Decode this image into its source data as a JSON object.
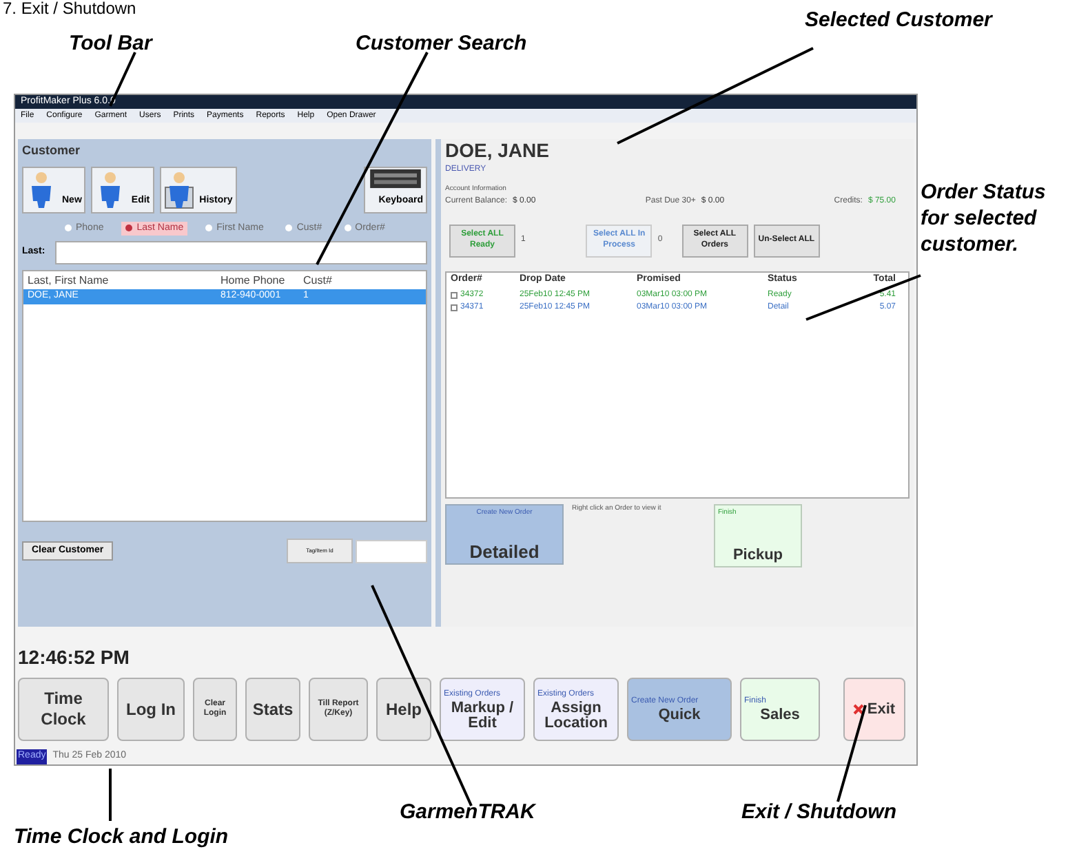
{
  "caption": "7. Exit / Shutdown",
  "callouts": [
    {
      "text": "Tool Bar"
    },
    {
      "text": "Customer Search"
    },
    {
      "text": "Selected Customer"
    },
    {
      "text": "Order Status for selected customer."
    },
    {
      "text": "GarmenTRAK"
    },
    {
      "text": "Time Clock and Login"
    },
    {
      "text": "Exit / Shutdown"
    }
  ],
  "window": {
    "title": "ProfitMaker Plus 6.0.0"
  },
  "menu": [
    "File",
    "Configure",
    "Garment",
    "Users",
    "Prints",
    "Payments",
    "Reports",
    "Help",
    "Open Drawer"
  ],
  "customer_panel": {
    "title": "Customer",
    "buttons": [
      {
        "label": "New",
        "kind": "person"
      },
      {
        "label": "Edit",
        "kind": "person"
      },
      {
        "label": "History",
        "kind": "history"
      },
      {
        "label": "Keyboard",
        "kind": "keyboard"
      }
    ],
    "search_by": [
      {
        "label": "Phone",
        "selected": false
      },
      {
        "label": "Last Name",
        "selected": true
      },
      {
        "label": "First Name",
        "selected": false
      },
      {
        "label": "Cust#",
        "selected": false
      },
      {
        "label": "Order#",
        "selected": false
      }
    ],
    "search_field": {
      "label": "Last:"
    },
    "list": {
      "columns": [
        "Last, First Name",
        "Home Phone",
        "Cust#"
      ],
      "rows": [
        {
          "cells": [
            "DOE, JANE",
            "812-940-0001",
            "1"
          ],
          "selected": true
        }
      ]
    },
    "clear_button": "Clear Customer",
    "tag_button": "Tag/Item Id"
  },
  "clock": "12:46:52 PM",
  "toolbar": [
    {
      "kind": "plain",
      "label": "Time Clock"
    },
    {
      "kind": "plain",
      "label": "Log In"
    },
    {
      "kind": "small",
      "label": "Clear Login"
    },
    {
      "kind": "plain",
      "label": "Stats"
    },
    {
      "kind": "small",
      "label": "Till Report (Z/Key)"
    },
    {
      "kind": "plain",
      "label": "Help"
    },
    {
      "kind": "tile",
      "caption": "Existing Orders",
      "label": "Markup / Edit",
      "color": "#eeeefb"
    },
    {
      "kind": "tile",
      "caption": "Existing Orders",
      "label": "Assign Location",
      "color": "#eeeefb"
    },
    {
      "kind": "tile",
      "caption": "Create New Order",
      "label": "Quick",
      "color": "#a9c1e1"
    },
    {
      "kind": "tile",
      "caption": "Finish",
      "label": "Sales",
      "color": "#e9fbe9"
    },
    {
      "kind": "exit",
      "label": "Exit",
      "color": "#fde5e5"
    }
  ],
  "status_bar": {
    "state": "Ready",
    "date": "Thu 25 Feb 2010"
  },
  "selected_customer": {
    "name": "DOE, JANE",
    "route": "DELIVERY",
    "account_heading": "Account Information",
    "balances": [
      {
        "label": "Current Balance:",
        "value": "$  0.00",
        "color": "#333333"
      },
      {
        "label": "Past Due 30+",
        "value": "$  0.00",
        "color": "#333333"
      },
      {
        "label": "Credits:",
        "value": "$  75.00",
        "color": "#2e9e3a"
      }
    ],
    "selection_buttons": [
      {
        "label": "Select ALL Ready",
        "count": "1",
        "disabled": false,
        "color": "#2e9e3a"
      },
      {
        "label": "Select ALL In Process",
        "count": "0",
        "disabled": true,
        "color": "#5a8ad0"
      },
      {
        "label": "Select ALL Orders",
        "disabled": false,
        "color": "#222222"
      },
      {
        "label": "Un-Select ALL",
        "disabled": false,
        "color": "#222222"
      }
    ],
    "orders": {
      "columns": [
        "Order#",
        "Drop Date",
        "Promised",
        "Status",
        "Total"
      ],
      "rows": [
        {
          "checked": false,
          "color": "#2e9e3a",
          "cells": [
            "34372",
            "25Feb10 12:45 PM",
            "03Mar10 03:00 PM",
            "Ready",
            "5.41"
          ]
        },
        {
          "checked": false,
          "color": "#3a6fc4",
          "cells": [
            "34371",
            "25Feb10 12:45 PM",
            "03Mar10 03:00 PM",
            "Detail",
            "5.07"
          ]
        }
      ]
    },
    "order_actions": [
      {
        "caption": "Create New Order",
        "label": "Detailed",
        "color": "#a9c1e1"
      },
      {
        "caption": "Finish",
        "label": "Pickup",
        "color": "#e9fbe9"
      }
    ],
    "hint": "Right click an Order to view it"
  }
}
